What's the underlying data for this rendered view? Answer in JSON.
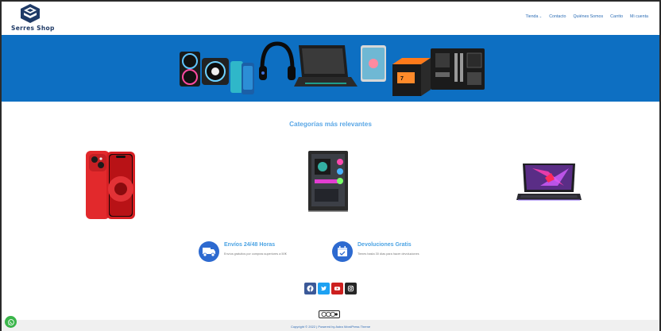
{
  "brand": {
    "name": "Serres Shop"
  },
  "nav": {
    "items": [
      "Tienda",
      "Contacto",
      "Quiénes Somos",
      "Carrito",
      "Mi cuenta"
    ]
  },
  "categories": {
    "title": "Categorías más relevantes",
    "items": [
      {
        "icon": "smartphone-icon"
      },
      {
        "icon": "pc-tower-icon"
      },
      {
        "icon": "laptop-icon"
      }
    ]
  },
  "features": [
    {
      "icon": "delivery-truck-icon",
      "title": "Envíos 24/48 Horas",
      "text": "Envíos gratuitos por compras superiores a 50€"
    },
    {
      "icon": "calendar-check-icon",
      "title": "Devoluciones Gratis",
      "text": "Tienes hasta 30 días para hacer devoluciones"
    }
  ],
  "social": [
    {
      "icon": "facebook-icon",
      "color": "#3b5998"
    },
    {
      "icon": "twitter-icon",
      "color": "#1da1f2"
    },
    {
      "icon": "youtube-icon",
      "color": "#cd201f"
    },
    {
      "icon": "instagram-icon",
      "color": "#262626"
    }
  ],
  "footer": {
    "text": "Copyright © 2022 | Powered by Astra WordPress Theme"
  },
  "colors": {
    "banner": "#0d6fc2",
    "accent": "#4da4e4",
    "brand": "#1f3a66"
  }
}
